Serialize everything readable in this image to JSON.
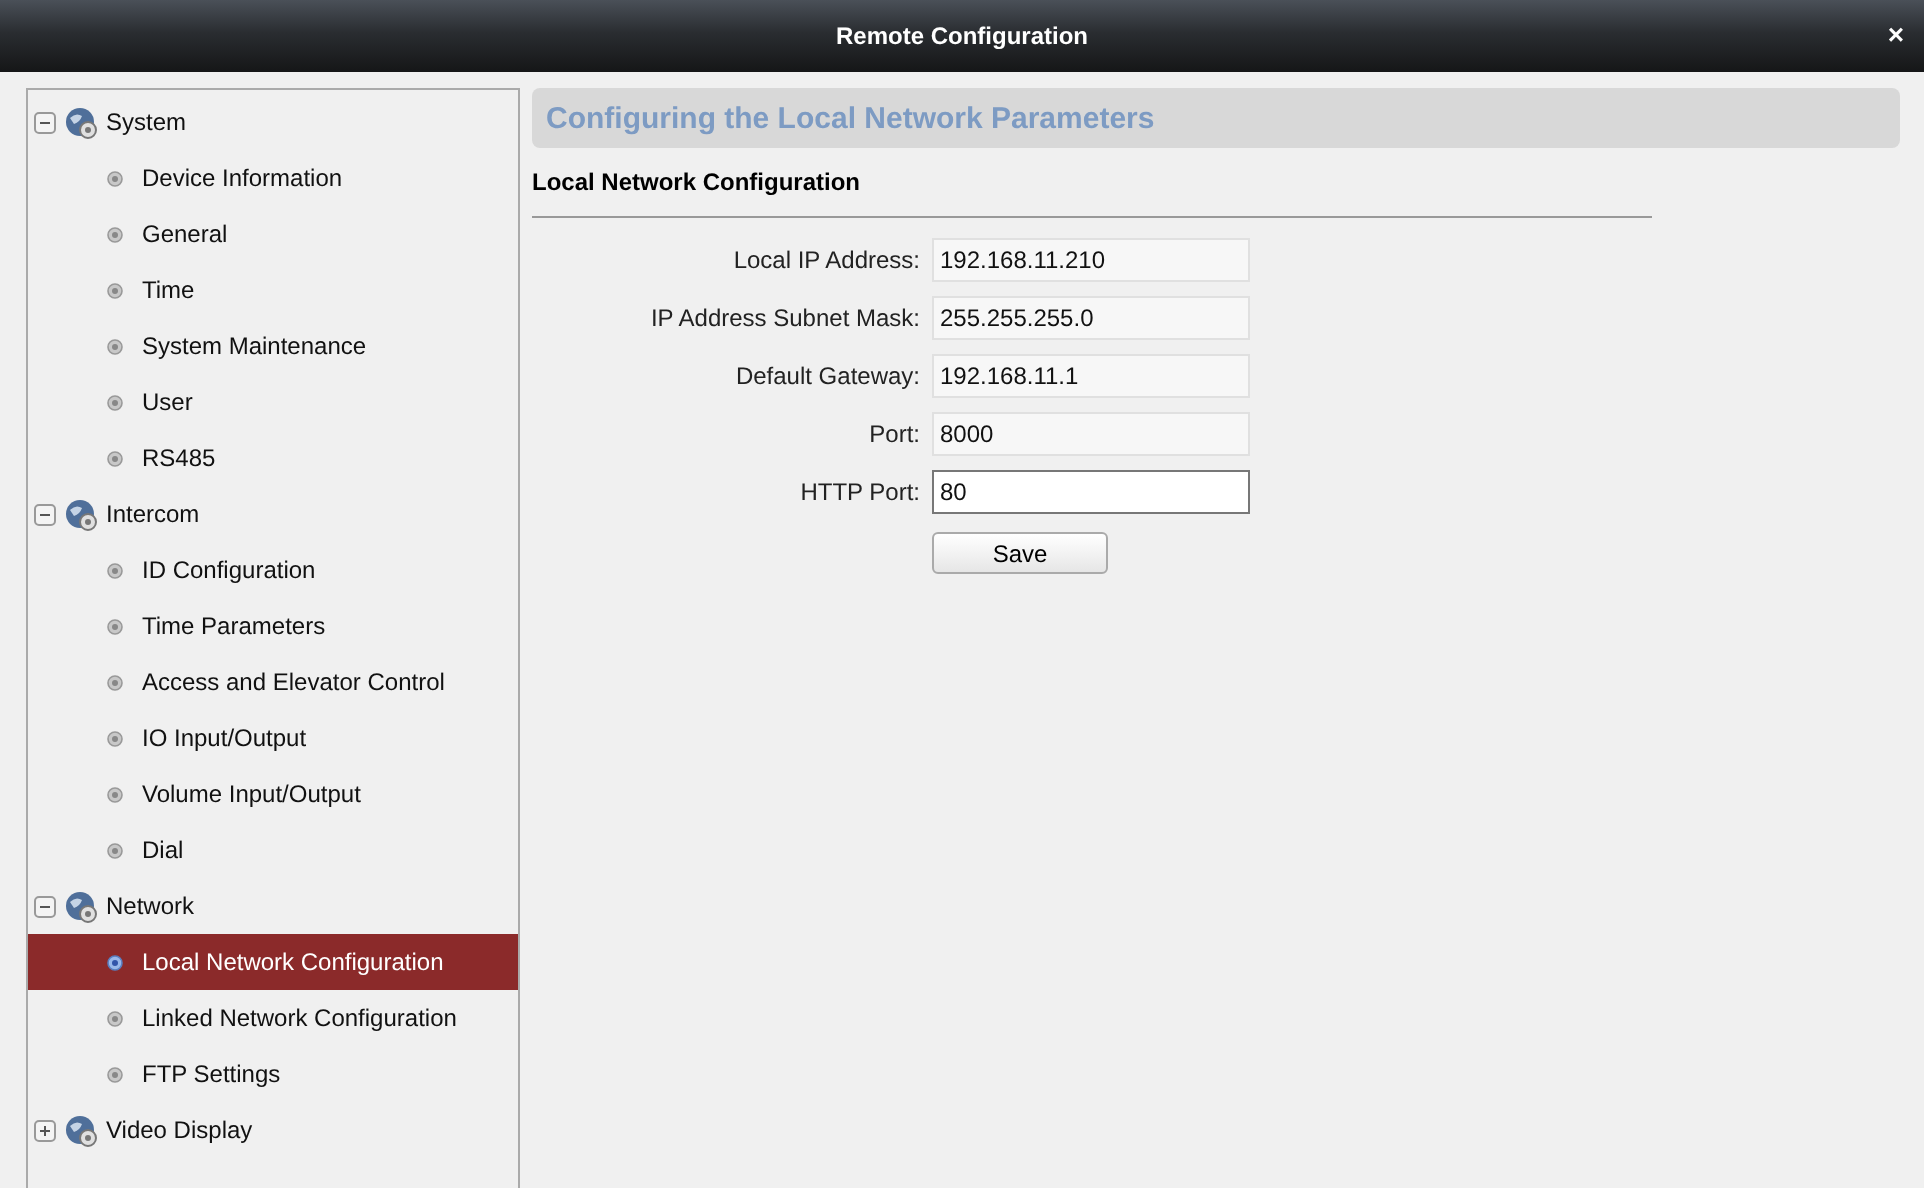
{
  "window": {
    "title": "Remote Configuration",
    "close": "×"
  },
  "tree": [
    {
      "label": "System",
      "expanded": true,
      "children": [
        {
          "label": "Device Information",
          "selected": false
        },
        {
          "label": "General",
          "selected": false
        },
        {
          "label": "Time",
          "selected": false
        },
        {
          "label": "System Maintenance",
          "selected": false
        },
        {
          "label": "User",
          "selected": false
        },
        {
          "label": "RS485",
          "selected": false
        }
      ]
    },
    {
      "label": "Intercom",
      "expanded": true,
      "children": [
        {
          "label": "ID Configuration",
          "selected": false
        },
        {
          "label": "Time Parameters",
          "selected": false
        },
        {
          "label": "Access and Elevator Control",
          "selected": false
        },
        {
          "label": "IO Input/Output",
          "selected": false
        },
        {
          "label": "Volume Input/Output",
          "selected": false
        },
        {
          "label": "Dial",
          "selected": false
        }
      ]
    },
    {
      "label": "Network",
      "expanded": true,
      "children": [
        {
          "label": "Local Network Configuration",
          "selected": true
        },
        {
          "label": "Linked Network Configuration",
          "selected": false
        },
        {
          "label": "FTP Settings",
          "selected": false
        }
      ]
    },
    {
      "label": "Video Display",
      "expanded": false
    }
  ],
  "page_title": "Configuring the Local Network Parameters",
  "section_title": "Local Network Configuration",
  "fields": [
    {
      "label": "Local IP Address:",
      "value": "192.168.11.210",
      "disabled": true
    },
    {
      "label": "IP Address Subnet Mask:",
      "value": "255.255.255.0",
      "disabled": true
    },
    {
      "label": "Default Gateway:",
      "value": "192.168.11.1",
      "disabled": true
    },
    {
      "label": "Port:",
      "value": "8000",
      "disabled": true
    },
    {
      "label": "HTTP Port:",
      "value": "80",
      "disabled": false
    }
  ],
  "save_button": "Save"
}
